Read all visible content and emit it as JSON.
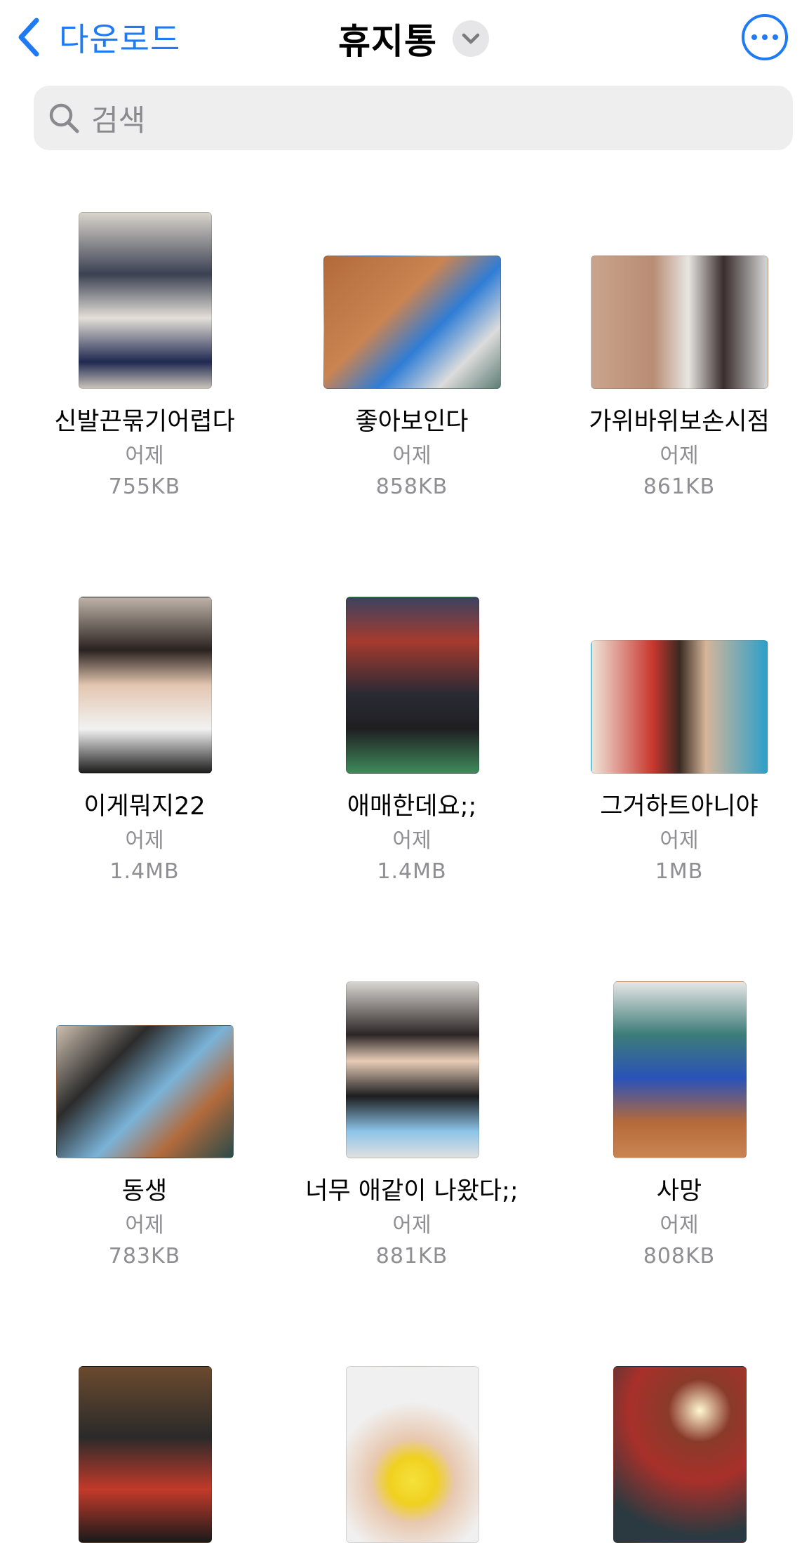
{
  "header": {
    "back_label": "다운로드",
    "title": "휴지통"
  },
  "search": {
    "placeholder": "검색"
  },
  "colors": {
    "accent": "#1e7bf5",
    "secondary_text": "#8e8e93",
    "search_bg": "#eeeeef"
  },
  "files": [
    {
      "name": "신발끈묶기어렵다",
      "date": "어제",
      "size": "755KB"
    },
    {
      "name": "좋아보인다",
      "date": "어제",
      "size": "858KB"
    },
    {
      "name": "가위바위보손시점",
      "date": "어제",
      "size": "861KB"
    },
    {
      "name": "이게뭐지22",
      "date": "어제",
      "size": "1.4MB"
    },
    {
      "name": "애매한데요;;",
      "date": "어제",
      "size": "1.4MB"
    },
    {
      "name": "그거하트아니야",
      "date": "어제",
      "size": "1MB"
    },
    {
      "name": "동생",
      "date": "어제",
      "size": "783KB"
    },
    {
      "name": "너무 애같이 나왔다;;",
      "date": "어제",
      "size": "881KB"
    },
    {
      "name": "사망",
      "date": "어제",
      "size": "808KB"
    }
  ]
}
